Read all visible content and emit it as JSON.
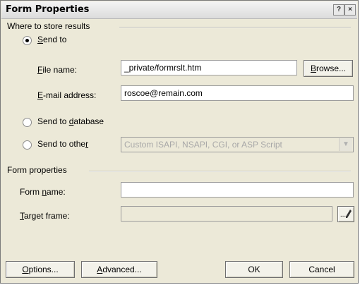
{
  "window": {
    "title": "Form Properties",
    "help_glyph": "?",
    "close_glyph": "×"
  },
  "results": {
    "section_label": "Where to store results",
    "send_to": {
      "pre": "",
      "key": "S",
      "post": "end to",
      "selected": true
    },
    "file_name": {
      "pre": "",
      "key": "F",
      "post": "ile name:",
      "value": "_private/formrslt.htm"
    },
    "browse": {
      "pre": "",
      "key": "B",
      "post": "rowse..."
    },
    "email": {
      "pre": "",
      "key": "E",
      "post": "-mail address:",
      "value": "roscoe@remain.com"
    },
    "send_to_database": {
      "pre": "Send to ",
      "key": "d",
      "post": "atabase",
      "selected": false
    },
    "send_to_other": {
      "pre": "Send to othe",
      "key": "r",
      "post": "",
      "selected": false,
      "select_value": "Custom ISAPI, NSAPI, CGI, or ASP Script"
    }
  },
  "form_props": {
    "section_label": "Form properties",
    "form_name": {
      "pre": "Form ",
      "key": "n",
      "post": "ame:",
      "value": ""
    },
    "target_frame": {
      "pre": "",
      "key": "T",
      "post": "arget frame:",
      "value": ""
    },
    "target_button_glyph": "..."
  },
  "buttons": {
    "options": {
      "pre": "",
      "key": "O",
      "post": "ptions..."
    },
    "advanced": {
      "pre": "",
      "key": "A",
      "post": "dvanced..."
    },
    "ok": "OK",
    "cancel": "Cancel"
  }
}
